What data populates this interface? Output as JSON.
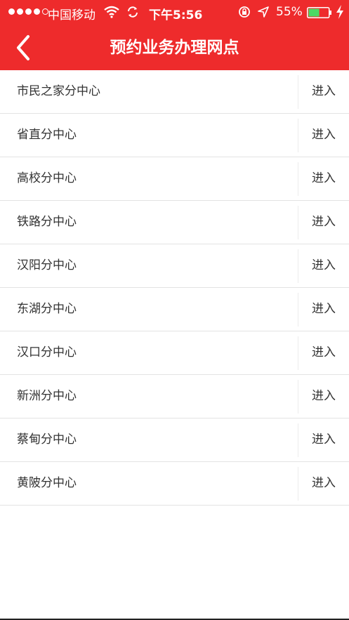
{
  "status_bar": {
    "carrier": "中国移动",
    "time": "下午5:56",
    "battery_percent": "55%",
    "battery_level": 0.55,
    "battery_color": "#4cd964",
    "icons": [
      "signal-dots-icon",
      "wifi-icon",
      "sync-icon",
      "rotation-lock-icon",
      "location-arrow-icon",
      "battery-icon",
      "charging-bolt-icon"
    ]
  },
  "nav": {
    "title": "预约业务办理网点",
    "back_icon": "chevron-left-icon",
    "background_color": "#ee2b2c"
  },
  "centers": [
    {
      "name": "市民之家分中心",
      "action": "进入"
    },
    {
      "name": "省直分中心",
      "action": "进入"
    },
    {
      "name": "高校分中心",
      "action": "进入"
    },
    {
      "name": "铁路分中心",
      "action": "进入"
    },
    {
      "name": "汉阳分中心",
      "action": "进入"
    },
    {
      "name": "东湖分中心",
      "action": "进入"
    },
    {
      "name": "汉口分中心",
      "action": "进入"
    },
    {
      "name": "新洲分中心",
      "action": "进入"
    },
    {
      "name": "蔡甸分中心",
      "action": "进入"
    },
    {
      "name": "黄陂分中心",
      "action": "进入"
    }
  ]
}
